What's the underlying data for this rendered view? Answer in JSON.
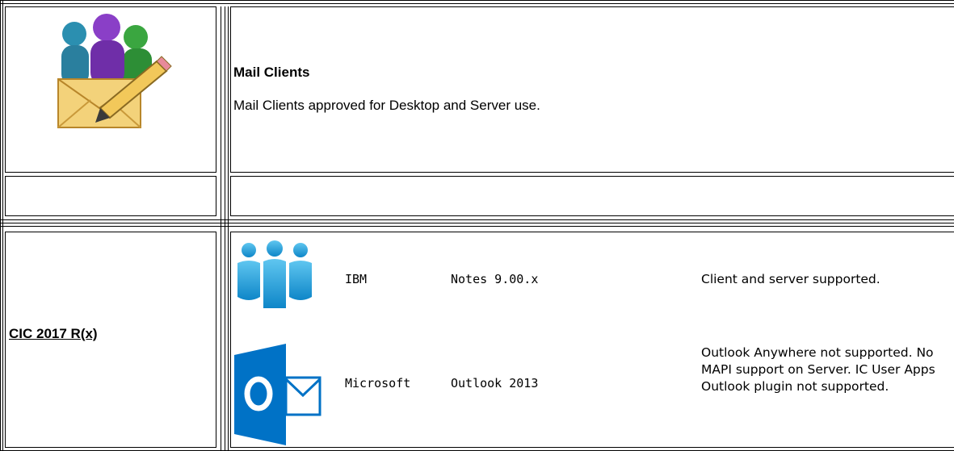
{
  "header": {
    "icon": "mail-users-icon",
    "title": "Mail Clients",
    "description": "Mail Clients approved for Desktop and Server use."
  },
  "version_link": "CIC 2017 R(x)",
  "clients": [
    {
      "icon": "ibm-notes-icon",
      "vendor": "IBM",
      "product": "Notes 9.00.x",
      "notes": "Client and server supported."
    },
    {
      "icon": "outlook-icon",
      "vendor": "Microsoft",
      "product": "Outlook 2013",
      "notes": "Outlook Anywhere not supported. No MAPI support on Server. IC User Apps Outlook plugin not supported."
    }
  ],
  "colors": {
    "outlook_blue": "#0072c6",
    "notes_blue": "#1fa3e0"
  }
}
